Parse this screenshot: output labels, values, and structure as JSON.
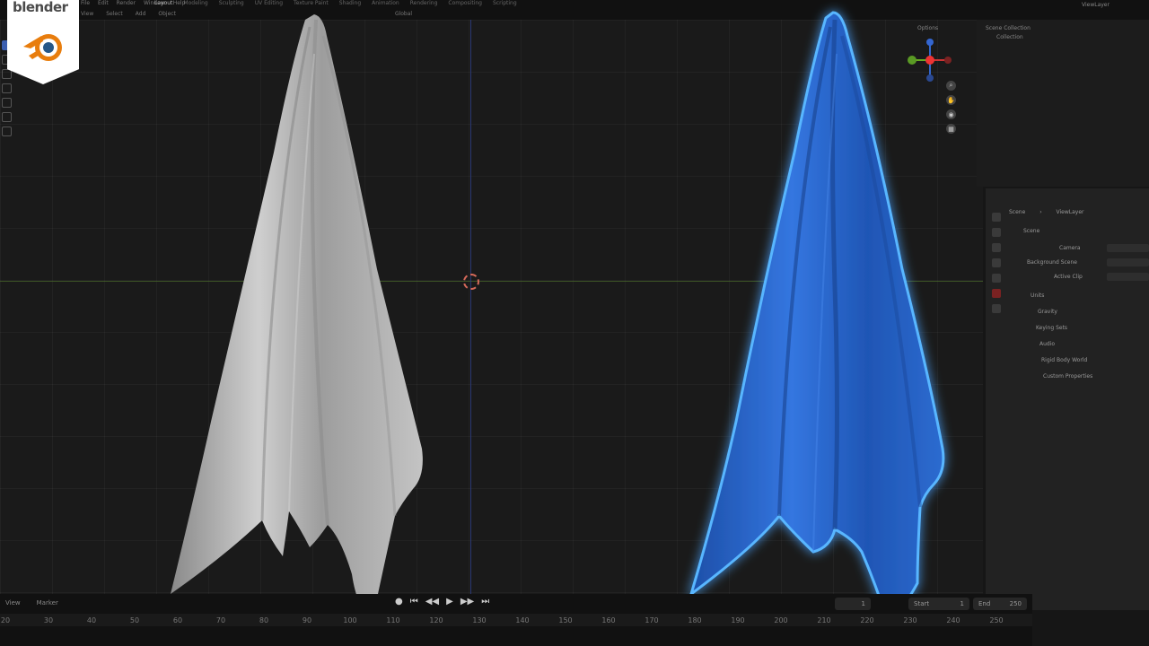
{
  "logo": {
    "wordmark": "blender"
  },
  "menu": [
    "File",
    "Edit",
    "Render",
    "Window",
    "Help"
  ],
  "workspace_tabs": [
    "Layout",
    "Modeling",
    "Sculpting",
    "UV Editing",
    "Texture Paint",
    "Shading",
    "Animation",
    "Rendering",
    "Compositing",
    "Scripting"
  ],
  "viewport_header": {
    "items": [
      "View",
      "Select",
      "Add",
      "Object"
    ],
    "mode": "Global",
    "options_label": "Options"
  },
  "outliner": {
    "root": "Scene Collection",
    "child": "Collection",
    "view_layer": "ViewLayer"
  },
  "properties": {
    "breadcrumb_scene": "Scene",
    "breadcrumb_layer": "ViewLayer",
    "section": "Scene",
    "camera_label": "Camera",
    "background_label": "Background Scene",
    "active_clip_label": "Active Clip",
    "panels": [
      "Units",
      "Gravity",
      "Keying Sets",
      "Audio",
      "Rigid Body World",
      "Custom Properties"
    ]
  },
  "timeline": {
    "view_label": "View",
    "marker_label": "Marker",
    "current_frame": "1",
    "start_label": "Start",
    "start_value": "1",
    "end_label": "End",
    "end_value": "250",
    "ruler": [
      "20",
      "30",
      "40",
      "50",
      "60",
      "70",
      "80",
      "90",
      "100",
      "110",
      "120",
      "130",
      "140",
      "150",
      "160",
      "170",
      "180",
      "190",
      "200",
      "210",
      "220",
      "230",
      "240",
      "250"
    ]
  },
  "colors": {
    "accent": "#3b5fb0",
    "cloth_grey": "#b5b5b5",
    "cloth_blue": "#2e6fd6",
    "glow": "#3fa2ff",
    "logo_orange": "#e87d0d",
    "logo_blue": "#265787"
  }
}
